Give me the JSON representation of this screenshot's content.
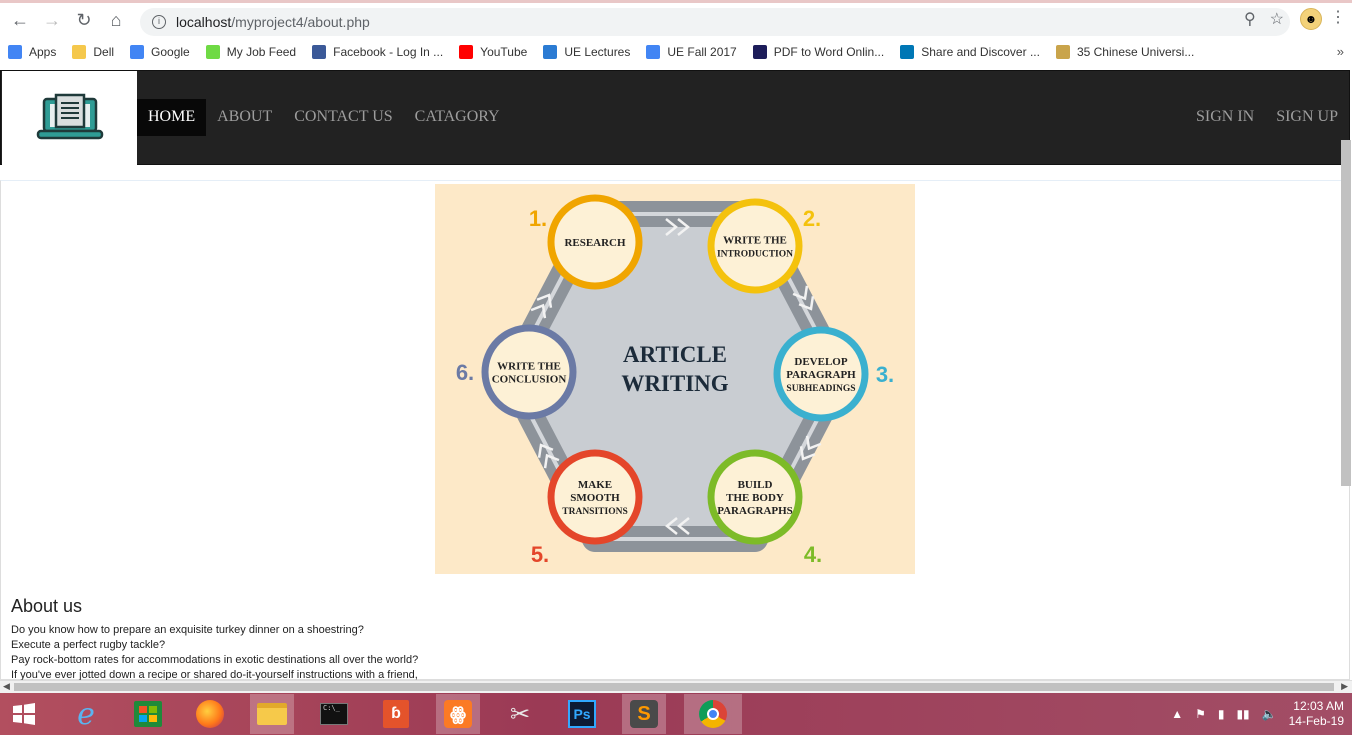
{
  "browser": {
    "url_host": "localhost",
    "url_path": "/myproject4/about.php"
  },
  "bookmarks": [
    {
      "label": "Apps",
      "icon": "apps-grid-icon",
      "color": "#4285f4"
    },
    {
      "label": "Dell",
      "icon": "folder-icon",
      "color": "#f5c84c"
    },
    {
      "label": "Google",
      "icon": "google-icon",
      "color": "#4285f4"
    },
    {
      "label": "My Job Feed",
      "icon": "upwork-icon",
      "color": "#6fda44"
    },
    {
      "label": "Facebook - Log In ...",
      "icon": "facebook-icon",
      "color": "#3b5998"
    },
    {
      "label": "YouTube",
      "icon": "youtube-icon",
      "color": "#ff0000"
    },
    {
      "label": "UE Lectures",
      "icon": "lectures-icon",
      "color": "#2b7bd3"
    },
    {
      "label": "UE Fall 2017",
      "icon": "google-icon",
      "color": "#4285f4"
    },
    {
      "label": "PDF to Word Onlin...",
      "icon": "pdf-icon",
      "color": "#1d1d5a"
    },
    {
      "label": "Share and Discover ...",
      "icon": "linkedin-icon",
      "color": "#0077b5"
    },
    {
      "label": "35 Chinese Universi...",
      "icon": "university-icon",
      "color": "#c9a44b"
    }
  ],
  "site": {
    "nav": [
      "HOME",
      "ABOUT",
      "CONTACT US",
      "CATAGORY"
    ],
    "nav_right": [
      "SIGN IN",
      "SIGN UP"
    ]
  },
  "infographic": {
    "title_line1": "ARTICLE",
    "title_line2": "WRITING",
    "steps": [
      {
        "num": "1.",
        "lines": [
          "RESEARCH"
        ],
        "color": "#f0a500"
      },
      {
        "num": "2.",
        "lines": [
          "WRITE THE",
          "INTRODUCTION"
        ],
        "color": "#f4c20d"
      },
      {
        "num": "3.",
        "lines": [
          "DEVELOP",
          "PARAGRAPH",
          "SUBHEADINGS"
        ],
        "color": "#3ab0cf"
      },
      {
        "num": "4.",
        "lines": [
          "BUILD",
          "THE BODY",
          "PARAGRAPHS"
        ],
        "color": "#7dbb28"
      },
      {
        "num": "5.",
        "lines": [
          "MAKE",
          "SMOOTH",
          "TRANSITIONS"
        ],
        "color": "#e4462a"
      },
      {
        "num": "6.",
        "lines": [
          "WRITE THE",
          "CONCLUSION"
        ],
        "color": "#6b7aa5"
      }
    ]
  },
  "about": {
    "title": "About us",
    "lines": [
      "Do you know how to prepare an exquisite turkey dinner on a shoestring?",
      "Execute a perfect rugby tackle?",
      "Pay rock-bottom rates for accommodations in exotic destinations all over the world?",
      "If you've ever jotted down a recipe or shared do-it-yourself instructions with a friend,"
    ]
  },
  "taskbar": {
    "time": "12:03 AM",
    "date": "14-Feb-19"
  }
}
